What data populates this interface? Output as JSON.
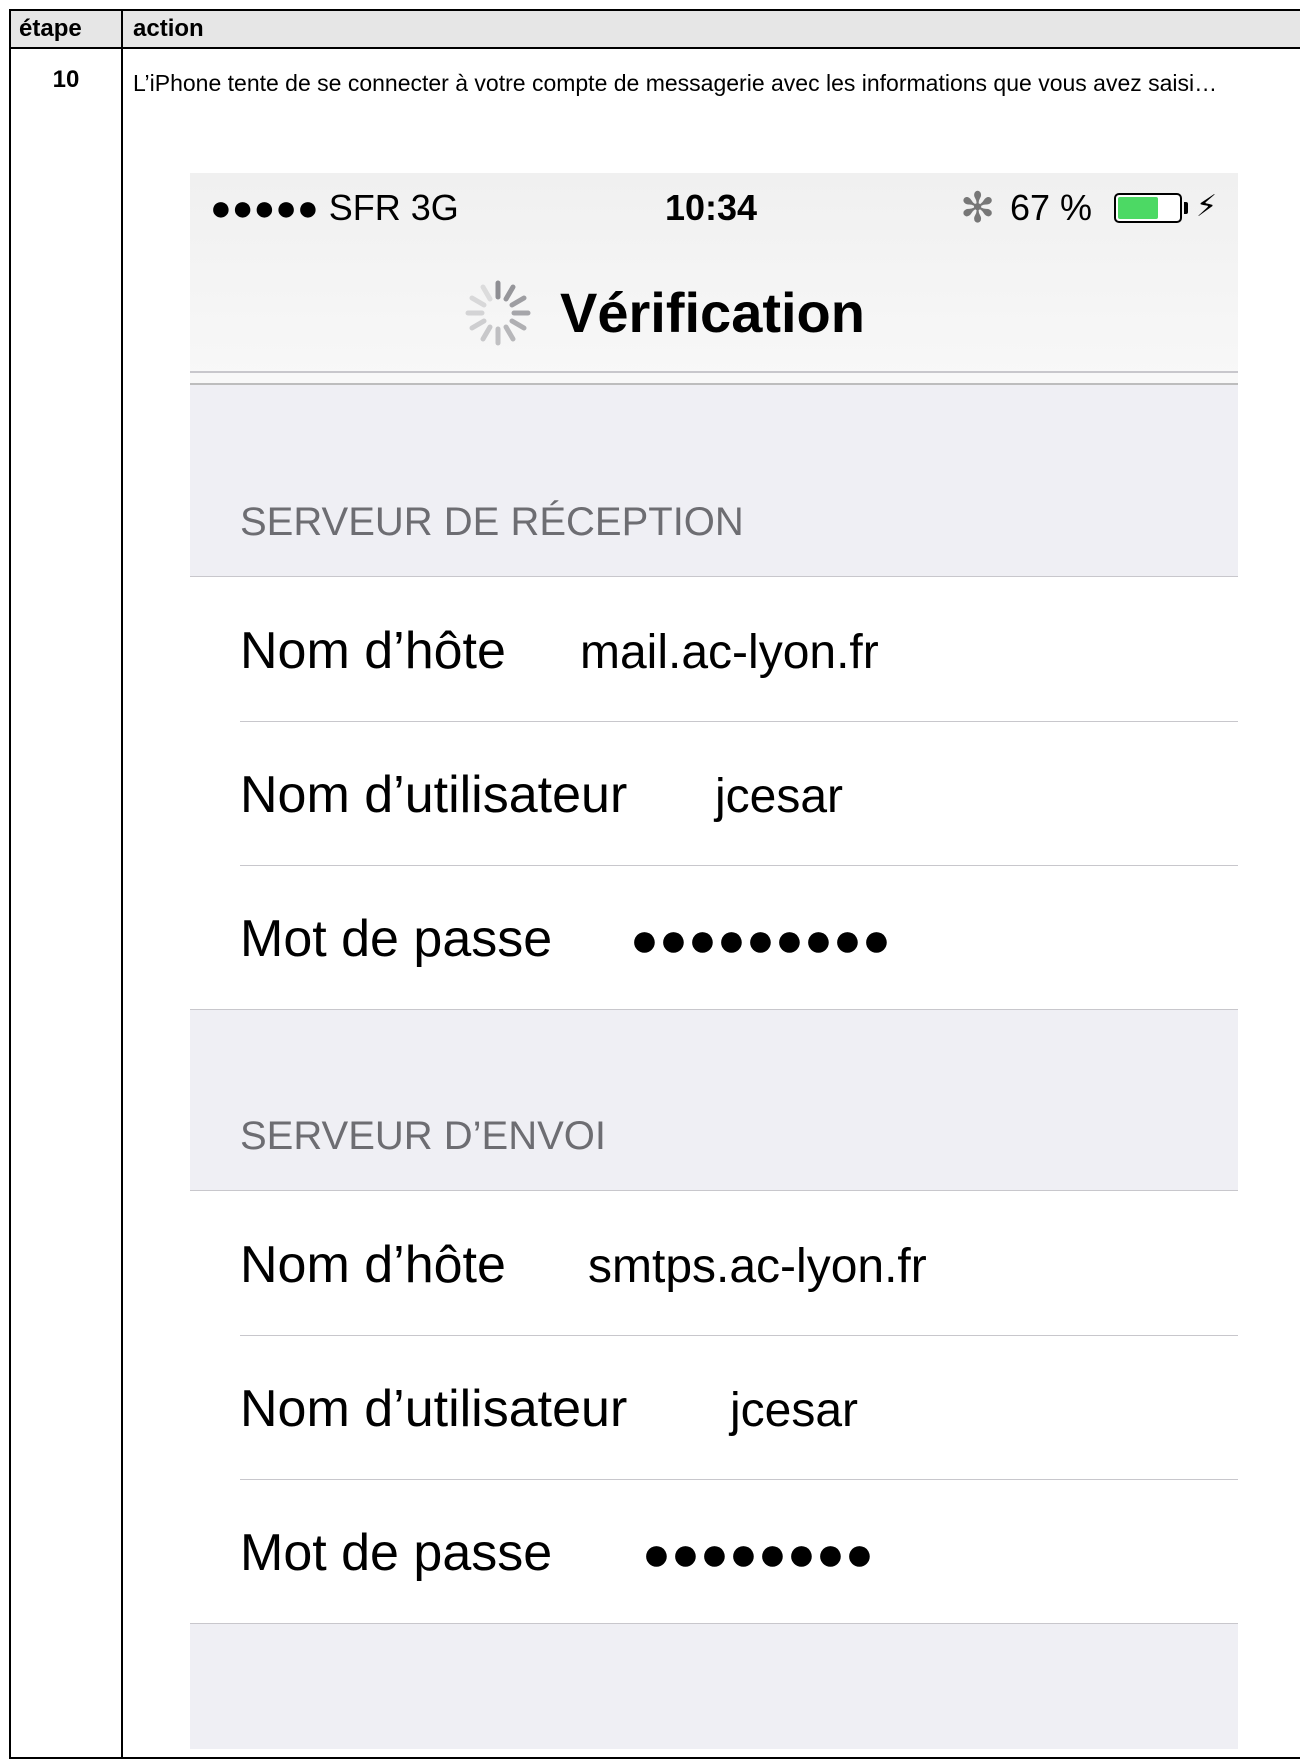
{
  "table": {
    "header_step": "étape",
    "header_action": "action",
    "step_number": "10",
    "description": "L’iPhone tente de se connecter à votre compte de messagerie avec les informations que vous avez saisi…"
  },
  "status_bar": {
    "carrier": "●●●●● SFR  3G",
    "time": "10:34",
    "bluetooth": "✻",
    "battery_percent": "67 %",
    "battery_level": 0.67,
    "charging": "⚡"
  },
  "nav": {
    "title": "Vérification"
  },
  "incoming": {
    "header": "SERVEUR DE RÉCEPTION",
    "rows": [
      {
        "label": "Nom d’hôte",
        "value": "mail.ac-lyon.fr"
      },
      {
        "label": "Nom d’utilisateur",
        "value": "jcesar"
      },
      {
        "label": "Mot de passe",
        "value": "●●●●●●●●●"
      }
    ]
  },
  "outgoing": {
    "header": "SERVEUR D’ENVOI",
    "rows": [
      {
        "label": "Nom d’hôte",
        "value": "smtps.ac-lyon.fr"
      },
      {
        "label": "Nom d’utilisateur",
        "value": "jcesar"
      },
      {
        "label": "Mot de passe",
        "value": "●●●●●●●●"
      }
    ]
  },
  "colors": {
    "battery_green": "#4cd964",
    "section_text": "#6d6d72",
    "grouped_background": "#efeff4"
  }
}
